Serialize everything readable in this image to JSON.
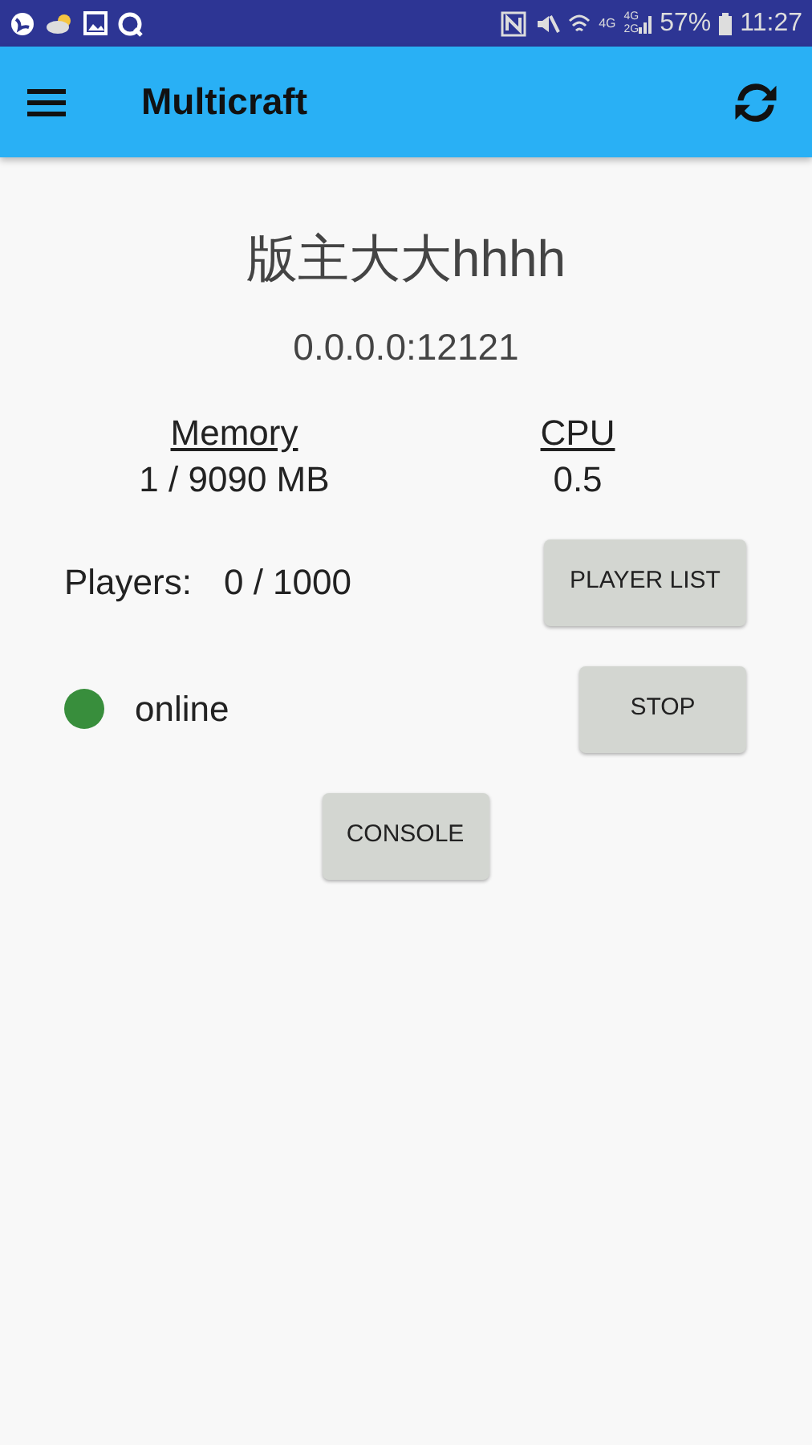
{
  "status_bar": {
    "network_1": "4G",
    "network_2": [
      "4G",
      "2G"
    ],
    "battery": "57%",
    "time": "11:27"
  },
  "app_bar": {
    "title": "Multicraft"
  },
  "server": {
    "name": "版主大大hhhh",
    "address": "0.0.0.0:12121"
  },
  "stats": [
    {
      "label": "Memory",
      "value": "1 / 9090 MB"
    },
    {
      "label": "CPU",
      "value": "0.5"
    }
  ],
  "players": {
    "label": "Players:",
    "count": "0 / 1000",
    "button": "PLAYER LIST"
  },
  "status": {
    "text": "online",
    "color": "#388e3c",
    "button": "STOP"
  },
  "console_button": "CONSOLE"
}
